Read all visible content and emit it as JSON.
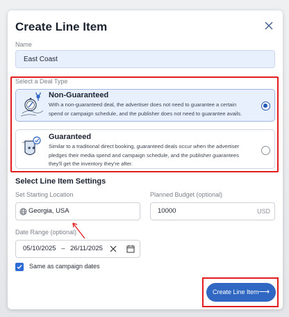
{
  "modal": {
    "title": "Create Line Item",
    "name_label": "Name",
    "name_value": "East Coast",
    "deal_type_label": "Select a Deal Type",
    "deal_types": [
      {
        "title": "Non-Guaranteed",
        "description": "With a non-guaranteed deal, the advertiser does not need to guarantee a certain spend or campaign schedule, and the publisher does not need to guarantee avails.",
        "selected": true,
        "icon": "compass-icon"
      },
      {
        "title": "Guaranteed",
        "description": "Similar to a traditional direct booking, guaranteed deals occur when the advertiser pledges their media spend and campaign schedule, and the publisher guarantees they'll get the inventory they're after.",
        "selected": false,
        "icon": "shield-check-icon"
      }
    ],
    "settings_title": "Select Line Item Settings",
    "location_label": "Set Starting Location",
    "location_value": "Georgia, USA",
    "budget_label": "Planned Budget (optional)",
    "budget_value": "10000",
    "budget_currency": "USD",
    "date_label": "Date Range (optional)",
    "date_start": "05/10/2025",
    "date_separator": "–",
    "date_end": "26/11/2025",
    "same_dates_label": "Same as campaign dates",
    "same_dates_checked": true,
    "cta_label": "Create Line Item"
  },
  "colors": {
    "accent": "#2f67c2",
    "highlight": "#e21d1d",
    "selected_bg": "#e8f0fd"
  }
}
